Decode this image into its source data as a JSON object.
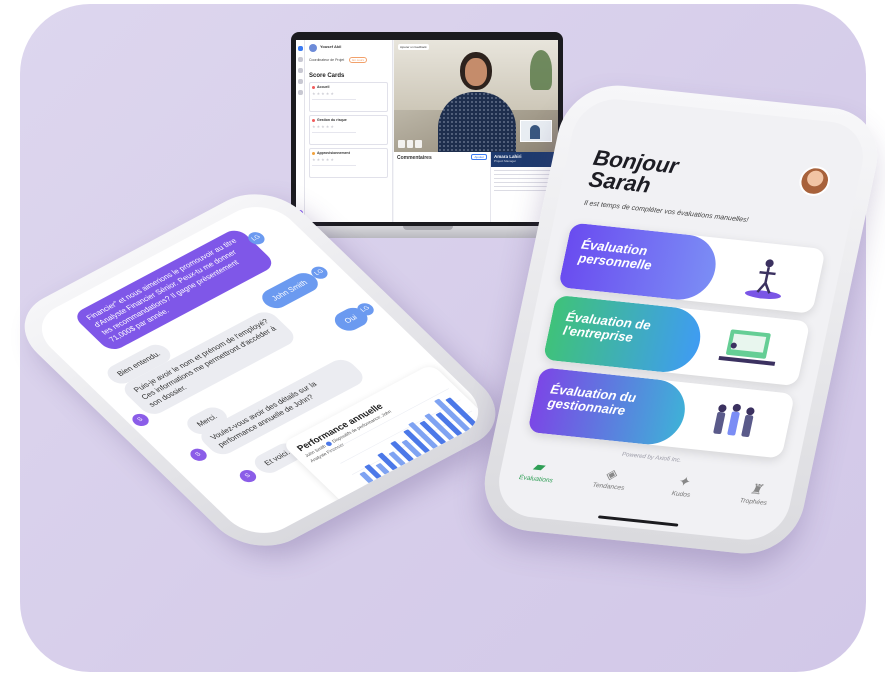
{
  "laptop": {
    "user_name": "Yousef Akil",
    "breadcrumb": "Coordinateur de Projet",
    "tag": "En cours",
    "scorecards_title": "Score Cards",
    "cards": [
      {
        "title": "Accueil",
        "color": "#f25c5c"
      },
      {
        "title": "Gestion du risque",
        "color": "#f25c5c"
      },
      {
        "title": "Approvisionnement",
        "color": "#f2a23c"
      }
    ],
    "video_button": "Ajouter un feedback",
    "comments_title": "Commentaires",
    "comments_button": "Ajouter",
    "profile_name": "Amara Lahiri",
    "profile_role": "Project Manager"
  },
  "chat": {
    "messages": [
      {
        "text": "Financier\" et nous aimerions le promouvoir au titre d'Analyste Financier Sénior. Peux-tu me donner tes recommandations? Il gagne présentement 71,000$ par année.",
        "who": "bot"
      },
      {
        "text": "Bien entendu.",
        "who": "user-grey"
      },
      {
        "text": "Puis-je avoir le nom et prénom de l'employé? Ces informations me permettront d'accéder à son dossier.",
        "who": "grey"
      },
      {
        "text": "John Smith",
        "who": "user"
      },
      {
        "text": "Oui",
        "who": "user"
      },
      {
        "text": "Merci.",
        "who": "grey"
      },
      {
        "text": "Voulez-vous avoir des détails sur la performance annuelle de John?",
        "who": "grey"
      },
      {
        "text": "Et voici.",
        "who": "grey"
      }
    ],
    "user_initials": "LG",
    "bot_initials": "S",
    "chart_card": {
      "title": "Performance annuelle",
      "legend_person": "John Smith",
      "legend_role": "Analyste Financier",
      "legend_series": "Dispositifs de performance: John"
    }
  },
  "chart_data": {
    "type": "bar",
    "title": "Performance annuelle",
    "series": [
      {
        "name": "Dispositifs de performance: John",
        "values": [
          3,
          4,
          3,
          5,
          4,
          6,
          5,
          7,
          8,
          7,
          8,
          7,
          10,
          9
        ]
      }
    ]
  },
  "app": {
    "greeting": "Bonjour Sarah",
    "subtitle": "Il est temps de compléter vos évaluations manuelles!",
    "cards": [
      {
        "label": "Évaluation personnelle",
        "grad_from": "#6a4cf0",
        "grad_to": "#7b8df5"
      },
      {
        "label": "Évaluation de l'entreprise",
        "grad_from": "#3fc27a",
        "grad_to": "#3f9cf2"
      },
      {
        "label": "Évaluation du gestionnaire",
        "grad_from": "#7b47e6",
        "grad_to": "#3fb0d8"
      }
    ],
    "powered_by": "Powered by Axiofi Inc.",
    "tabs": [
      {
        "label": "Évaluations",
        "icon": "clipboard-icon",
        "glyph": "▰"
      },
      {
        "label": "Tendances",
        "icon": "trend-icon",
        "glyph": "◈"
      },
      {
        "label": "Kudos",
        "icon": "star-icon",
        "glyph": "✦"
      },
      {
        "label": "Trophées",
        "icon": "trophy-icon",
        "glyph": "♜"
      }
    ],
    "active_tab": "Évaluations"
  }
}
